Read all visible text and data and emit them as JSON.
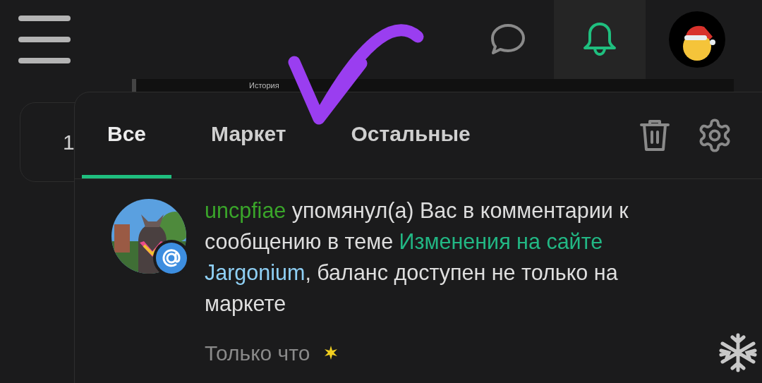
{
  "top_bar": {
    "messages_active": false,
    "notifications_active": true
  },
  "background": {
    "card_text": "1",
    "strip_text": "История"
  },
  "notifications_panel": {
    "tabs": [
      {
        "label": "Все",
        "selected": true
      },
      {
        "label": "Маркет",
        "selected": false
      },
      {
        "label": "Остальные",
        "selected": false
      }
    ],
    "items": [
      {
        "parts": [
          {
            "kind": "user",
            "text": "uncpfiae"
          },
          {
            "kind": "plain",
            "text": " упомянул(а) Вас в комментарии к сообщению в теме "
          },
          {
            "kind": "link",
            "text": "Изменения на сайте "
          },
          {
            "kind": "mention",
            "text": "Jargonium"
          },
          {
            "kind": "plain",
            "text": ", баланс доступен не только на маркете"
          }
        ],
        "time": "Только что",
        "unread": true
      }
    ]
  }
}
